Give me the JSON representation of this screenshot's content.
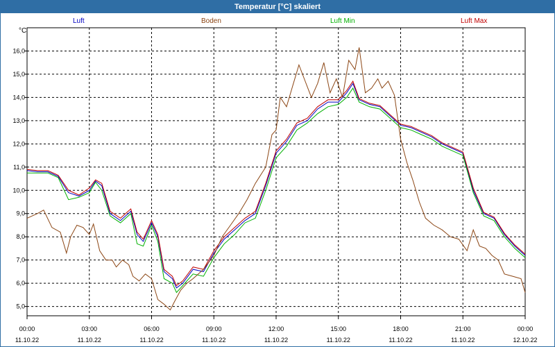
{
  "window": {
    "title": "Temperatur [°C] skaliert"
  },
  "legend": [
    {
      "label": "Luft",
      "color": "#0000c0"
    },
    {
      "label": "Boden",
      "color": "#8b4513"
    },
    {
      "label": "Luft Min",
      "color": "#00b000"
    },
    {
      "label": "Luft Max",
      "color": "#c00000"
    }
  ],
  "chart_data": {
    "type": "line",
    "title": "Temperatur [°C] skaliert",
    "ylabel": "°C",
    "xlabel": "",
    "ylim": [
      4.6,
      17.0
    ],
    "xlim": [
      0,
      24
    ],
    "yticks": [
      "5,0",
      "6,0",
      "7,0",
      "8,0",
      "9,0",
      "10,0",
      "11,0",
      "12,0",
      "13,0",
      "14,0",
      "15,0",
      "16,0"
    ],
    "xticks": [
      {
        "time": "00:00",
        "date": "11.10.22"
      },
      {
        "time": "03:00",
        "date": "11.10.22"
      },
      {
        "time": "06:00",
        "date": "11.10.22"
      },
      {
        "time": "09:00",
        "date": "11.10.22"
      },
      {
        "time": "12:00",
        "date": "11.10.22"
      },
      {
        "time": "15:00",
        "date": "11.10.22"
      },
      {
        "time": "18:00",
        "date": "11.10.22"
      },
      {
        "time": "21:00",
        "date": "11.10.22"
      },
      {
        "time": "00:00",
        "date": "12.10.22"
      }
    ],
    "grid": true,
    "legend_position": "top",
    "series": [
      {
        "name": "Luft",
        "color": "#0000c0",
        "points": [
          [
            0,
            10.85
          ],
          [
            0.5,
            10.8
          ],
          [
            1,
            10.8
          ],
          [
            1.5,
            10.6
          ],
          [
            2,
            9.9
          ],
          [
            2.5,
            9.75
          ],
          [
            3,
            10.0
          ],
          [
            3.3,
            10.4
          ],
          [
            3.6,
            10.2
          ],
          [
            4,
            9.0
          ],
          [
            4.5,
            8.7
          ],
          [
            5,
            9.1
          ],
          [
            5.3,
            8.1
          ],
          [
            5.6,
            7.8
          ],
          [
            6,
            8.6
          ],
          [
            6.3,
            8.0
          ],
          [
            6.6,
            6.5
          ],
          [
            7,
            6.2
          ],
          [
            7.2,
            5.8
          ],
          [
            7.5,
            6.0
          ],
          [
            8,
            6.6
          ],
          [
            8.5,
            6.5
          ],
          [
            9,
            7.3
          ],
          [
            9.5,
            7.9
          ],
          [
            10,
            8.3
          ],
          [
            10.5,
            8.7
          ],
          [
            11,
            9.0
          ],
          [
            11.5,
            10.2
          ],
          [
            12,
            11.6
          ],
          [
            12.5,
            12.1
          ],
          [
            13,
            12.8
          ],
          [
            13.5,
            13.0
          ],
          [
            14,
            13.5
          ],
          [
            14.5,
            13.8
          ],
          [
            15,
            13.8
          ],
          [
            15.4,
            14.2
          ],
          [
            15.7,
            14.6
          ],
          [
            16,
            13.9
          ],
          [
            16.5,
            13.7
          ],
          [
            17,
            13.6
          ],
          [
            17.5,
            13.2
          ],
          [
            18,
            12.8
          ],
          [
            18.5,
            12.7
          ],
          [
            19,
            12.5
          ],
          [
            19.5,
            12.3
          ],
          [
            20,
            12.0
          ],
          [
            20.5,
            11.8
          ],
          [
            21,
            11.6
          ],
          [
            21.5,
            10.0
          ],
          [
            22,
            9.0
          ],
          [
            22.5,
            8.8
          ],
          [
            23,
            8.1
          ],
          [
            23.5,
            7.6
          ],
          [
            24,
            7.2
          ]
        ]
      },
      {
        "name": "Luft Max",
        "color": "#c00000",
        "points": [
          [
            0,
            10.9
          ],
          [
            0.5,
            10.85
          ],
          [
            1,
            10.85
          ],
          [
            1.5,
            10.65
          ],
          [
            2,
            10.0
          ],
          [
            2.5,
            9.8
          ],
          [
            3,
            10.1
          ],
          [
            3.3,
            10.45
          ],
          [
            3.6,
            10.3
          ],
          [
            4,
            9.1
          ],
          [
            4.5,
            8.8
          ],
          [
            5,
            9.2
          ],
          [
            5.3,
            8.2
          ],
          [
            5.6,
            7.9
          ],
          [
            6,
            8.7
          ],
          [
            6.3,
            8.1
          ],
          [
            6.6,
            6.6
          ],
          [
            7,
            6.3
          ],
          [
            7.2,
            5.9
          ],
          [
            7.5,
            6.1
          ],
          [
            8,
            6.7
          ],
          [
            8.5,
            6.6
          ],
          [
            9,
            7.4
          ],
          [
            9.5,
            8.0
          ],
          [
            10,
            8.4
          ],
          [
            10.5,
            8.8
          ],
          [
            11,
            9.1
          ],
          [
            11.5,
            10.3
          ],
          [
            12,
            11.7
          ],
          [
            12.5,
            12.2
          ],
          [
            13,
            12.9
          ],
          [
            13.5,
            13.1
          ],
          [
            14,
            13.6
          ],
          [
            14.5,
            13.9
          ],
          [
            15,
            13.9
          ],
          [
            15.4,
            14.3
          ],
          [
            15.7,
            14.7
          ],
          [
            16,
            13.95
          ],
          [
            16.5,
            13.75
          ],
          [
            17,
            13.65
          ],
          [
            17.5,
            13.25
          ],
          [
            18,
            12.85
          ],
          [
            18.5,
            12.75
          ],
          [
            19,
            12.55
          ],
          [
            19.5,
            12.35
          ],
          [
            20,
            12.05
          ],
          [
            20.5,
            11.85
          ],
          [
            21,
            11.65
          ],
          [
            21.5,
            10.1
          ],
          [
            22,
            9.05
          ],
          [
            22.5,
            8.85
          ],
          [
            23,
            8.15
          ],
          [
            23.5,
            7.65
          ],
          [
            24,
            7.25
          ]
        ]
      },
      {
        "name": "Luft Min",
        "color": "#00b000",
        "points": [
          [
            0,
            10.75
          ],
          [
            0.5,
            10.75
          ],
          [
            1,
            10.75
          ],
          [
            1.5,
            10.55
          ],
          [
            2,
            9.6
          ],
          [
            2.5,
            9.7
          ],
          [
            3,
            9.9
          ],
          [
            3.3,
            10.35
          ],
          [
            3.6,
            10.0
          ],
          [
            4,
            8.9
          ],
          [
            4.5,
            8.6
          ],
          [
            5,
            9.0
          ],
          [
            5.3,
            7.7
          ],
          [
            5.6,
            7.6
          ],
          [
            6,
            8.5
          ],
          [
            6.3,
            7.8
          ],
          [
            6.6,
            6.2
          ],
          [
            7,
            6.0
          ],
          [
            7.2,
            5.6
          ],
          [
            7.5,
            5.9
          ],
          [
            8,
            6.4
          ],
          [
            8.5,
            6.3
          ],
          [
            9,
            7.1
          ],
          [
            9.5,
            7.7
          ],
          [
            10,
            8.1
          ],
          [
            10.5,
            8.6
          ],
          [
            11,
            8.8
          ],
          [
            11.5,
            10.0
          ],
          [
            12,
            11.4
          ],
          [
            12.5,
            11.9
          ],
          [
            13,
            12.6
          ],
          [
            13.5,
            12.9
          ],
          [
            14,
            13.3
          ],
          [
            14.5,
            13.6
          ],
          [
            15,
            13.7
          ],
          [
            15.4,
            14.0
          ],
          [
            15.7,
            14.4
          ],
          [
            16,
            13.8
          ],
          [
            16.5,
            13.6
          ],
          [
            17,
            13.5
          ],
          [
            17.5,
            13.1
          ],
          [
            18,
            12.7
          ],
          [
            18.5,
            12.6
          ],
          [
            19,
            12.4
          ],
          [
            19.5,
            12.2
          ],
          [
            20,
            11.9
          ],
          [
            20.5,
            11.7
          ],
          [
            21,
            11.5
          ],
          [
            21.5,
            9.9
          ],
          [
            22,
            8.9
          ],
          [
            22.5,
            8.7
          ],
          [
            23,
            8.0
          ],
          [
            23.5,
            7.5
          ],
          [
            24,
            7.1
          ]
        ]
      },
      {
        "name": "Boden",
        "color": "#8b4513",
        "points": [
          [
            0,
            8.8
          ],
          [
            0.5,
            9.0
          ],
          [
            0.8,
            9.15
          ],
          [
            1.2,
            8.4
          ],
          [
            1.6,
            8.2
          ],
          [
            1.9,
            7.3
          ],
          [
            2.1,
            8.0
          ],
          [
            2.4,
            8.5
          ],
          [
            2.7,
            8.4
          ],
          [
            3,
            8.1
          ],
          [
            3.2,
            8.55
          ],
          [
            3.5,
            7.4
          ],
          [
            3.8,
            7.0
          ],
          [
            4.1,
            7.0
          ],
          [
            4.3,
            6.7
          ],
          [
            4.6,
            7.0
          ],
          [
            4.9,
            6.8
          ],
          [
            5.1,
            6.3
          ],
          [
            5.4,
            6.1
          ],
          [
            5.7,
            6.4
          ],
          [
            6.0,
            6.2
          ],
          [
            6.3,
            5.3
          ],
          [
            6.6,
            5.1
          ],
          [
            6.9,
            4.85
          ],
          [
            7.1,
            5.2
          ],
          [
            7.4,
            5.7
          ],
          [
            7.7,
            6.0
          ],
          [
            8,
            6.2
          ],
          [
            8.5,
            6.6
          ],
          [
            9,
            7.2
          ],
          [
            9.4,
            8.0
          ],
          [
            9.8,
            8.5
          ],
          [
            10.2,
            9.0
          ],
          [
            10.6,
            9.6
          ],
          [
            11,
            10.3
          ],
          [
            11.5,
            11.0
          ],
          [
            11.8,
            12.4
          ],
          [
            12.0,
            12.6
          ],
          [
            12.2,
            14.0
          ],
          [
            12.5,
            13.6
          ],
          [
            12.8,
            14.5
          ],
          [
            13.1,
            15.4
          ],
          [
            13.4,
            14.7
          ],
          [
            13.7,
            14.0
          ],
          [
            14.0,
            14.6
          ],
          [
            14.3,
            15.5
          ],
          [
            14.6,
            14.2
          ],
          [
            14.9,
            14.8
          ],
          [
            15.2,
            14.0
          ],
          [
            15.5,
            15.6
          ],
          [
            15.8,
            15.2
          ],
          [
            16.0,
            16.15
          ],
          [
            16.3,
            14.2
          ],
          [
            16.6,
            14.4
          ],
          [
            16.9,
            14.8
          ],
          [
            17.1,
            14.4
          ],
          [
            17.4,
            14.7
          ],
          [
            17.7,
            14.1
          ],
          [
            18.0,
            12.2
          ],
          [
            18.3,
            11.2
          ],
          [
            18.6,
            10.4
          ],
          [
            18.9,
            9.5
          ],
          [
            19.2,
            8.8
          ],
          [
            19.6,
            8.5
          ],
          [
            20,
            8.3
          ],
          [
            20.4,
            8.0
          ],
          [
            20.8,
            7.9
          ],
          [
            21.2,
            7.4
          ],
          [
            21.5,
            8.3
          ],
          [
            21.8,
            7.6
          ],
          [
            22.1,
            7.5
          ],
          [
            22.4,
            7.2
          ],
          [
            22.7,
            7.0
          ],
          [
            23.0,
            6.4
          ],
          [
            23.4,
            6.3
          ],
          [
            23.8,
            6.2
          ],
          [
            24,
            5.6
          ]
        ]
      }
    ]
  }
}
